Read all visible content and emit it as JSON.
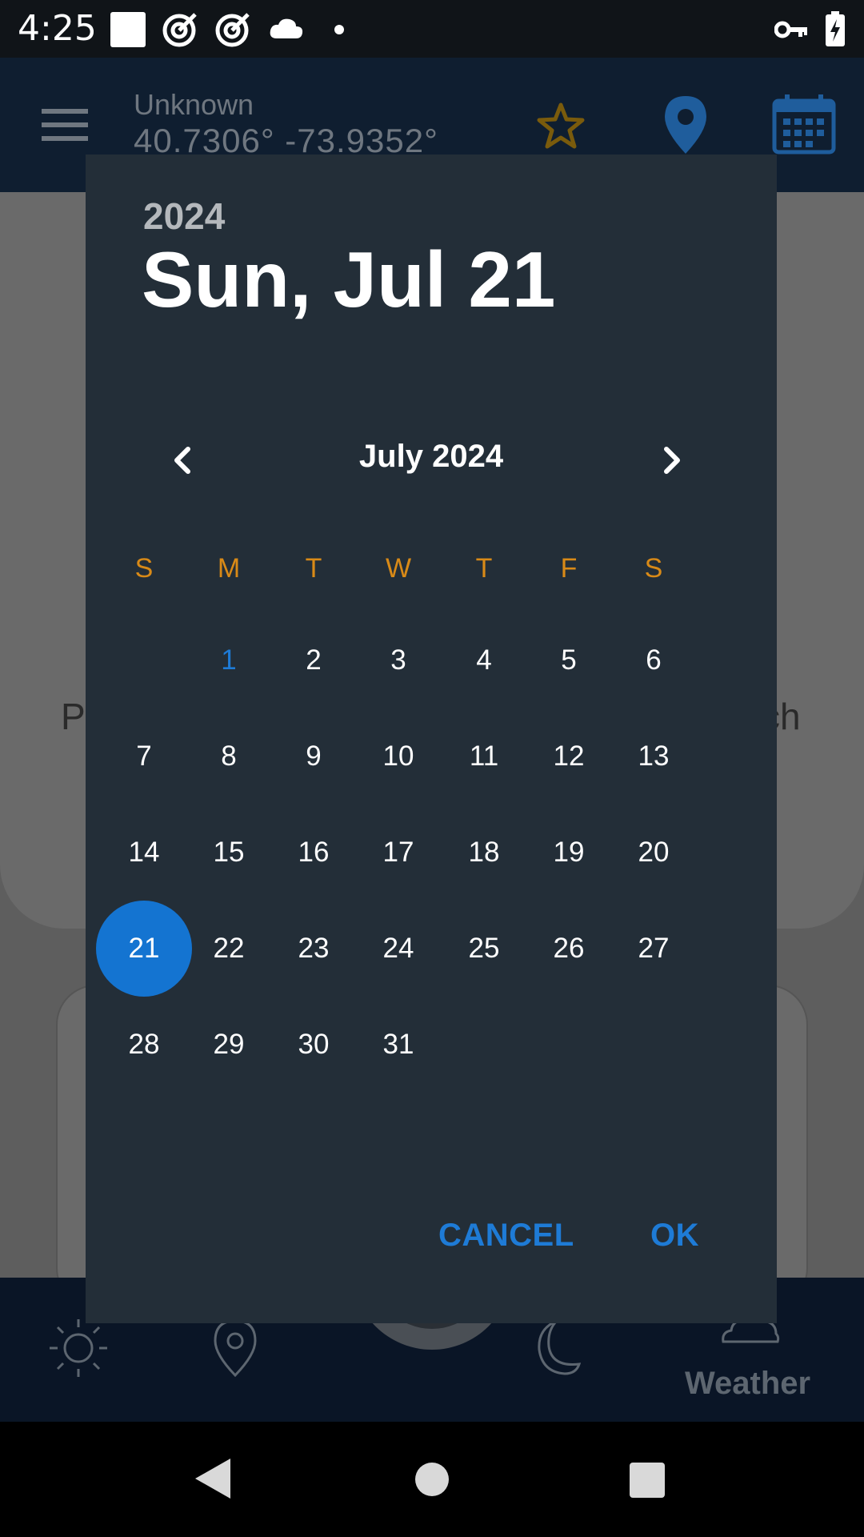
{
  "status_bar": {
    "time": "4:25",
    "icons": [
      "square-icon",
      "target-icon",
      "target-icon",
      "cloud-icon",
      "dot-icon",
      "key-icon",
      "battery-charging-icon"
    ]
  },
  "app_header": {
    "location_name": "Unknown",
    "coordinates": "40.7306°  -73.9352°"
  },
  "background": {
    "left_text": "P",
    "right_text": "ch"
  },
  "bottom_nav": {
    "weather_label": "Weather"
  },
  "dialog": {
    "year": "2024",
    "date_heading": "Sun, Jul 21",
    "month_label": "July 2024",
    "weekdays": [
      "S",
      "M",
      "T",
      "W",
      "T",
      "F",
      "S"
    ],
    "first_weekday_index": 1,
    "days_in_month": 31,
    "today_day": 1,
    "selected_day": 21,
    "cancel_label": "CANCEL",
    "ok_label": "OK"
  },
  "colors": {
    "accent": "#1e7bd6",
    "weekday": "#d98a17",
    "dialog_bg": "#232e38",
    "selected_bg": "#1474d1"
  }
}
